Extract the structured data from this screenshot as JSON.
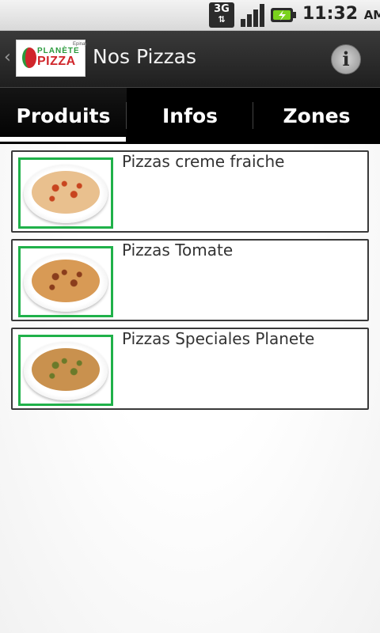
{
  "status_bar": {
    "network_type": "3G",
    "time": "11:32",
    "ampm": "AM",
    "icons": [
      "network-3g-icon",
      "signal-icon",
      "battery-charging-icon"
    ]
  },
  "header": {
    "title": "Nos Pizzas",
    "logo": {
      "line1": "PLANÈTE",
      "line2": "PIZZA",
      "tag": "Epinay"
    },
    "icons": [
      "back-chevron-icon",
      "info-icon"
    ]
  },
  "tabs": [
    {
      "label": "Produits",
      "active": true
    },
    {
      "label": "Infos",
      "active": false
    },
    {
      "label": "Zones",
      "active": false
    }
  ],
  "products": [
    {
      "label": "Pizzas creme fraiche",
      "thumb_colors": [
        "#e9c08e",
        "#c8451f"
      ]
    },
    {
      "label": "Pizzas Tomate",
      "thumb_colors": [
        "#d89a55",
        "#8a3d1c"
      ]
    },
    {
      "label": "Pizzas Speciales Planete",
      "thumb_colors": [
        "#c9914e",
        "#6b7a2a"
      ]
    }
  ],
  "colors": {
    "thumb_border": "#20b14a",
    "tab_bar": "#000000",
    "title_bar": "#2a2a2a"
  }
}
